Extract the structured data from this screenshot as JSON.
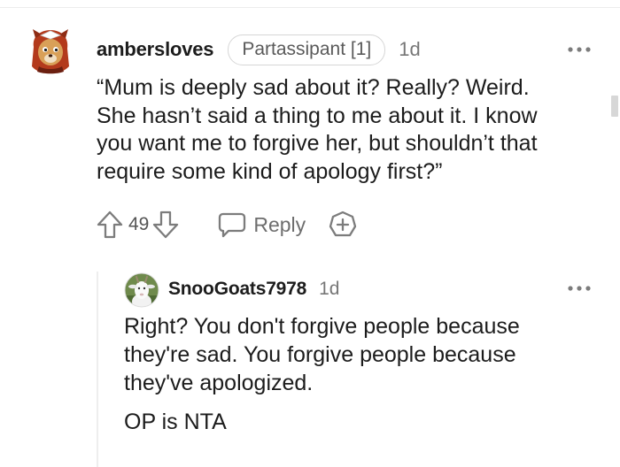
{
  "comment": {
    "username": "ambersloves",
    "flair": "Partassipant [1]",
    "timestamp": "1d",
    "avatar_icon": "cartoon-animal-avatar-icon",
    "body": "“Mum is deeply sad about it? Really? Weird.\nShe hasn’t said a thing to me about it. I know\nyou want me to forgive her, but shouldn’t that\nrequire some kind of apology first?”",
    "upvote_icon": "upvote-arrow-icon",
    "vote_count": "49",
    "downvote_icon": "downvote-arrow-icon",
    "reply_icon": "speech-bubble-icon",
    "reply_label": "Reply",
    "award_icon": "award-plus-icon",
    "more_icon": "more-dots-icon"
  },
  "reply": {
    "username": "SnooGoats7978",
    "timestamp": "1d",
    "avatar_icon": "goat-avatar-icon",
    "paragraphs": [
      "Right? You don't forgive people because\nthey're sad. You forgive people because\nthey've apologized.",
      "OP is NTA"
    ],
    "more_icon": "more-dots-icon"
  },
  "colors": {
    "text": "#1c1c1c",
    "meta": "#777777",
    "icon": "#7c7c7c",
    "flair_border": "#d6d6d6",
    "thread_line": "#eeeeee"
  }
}
